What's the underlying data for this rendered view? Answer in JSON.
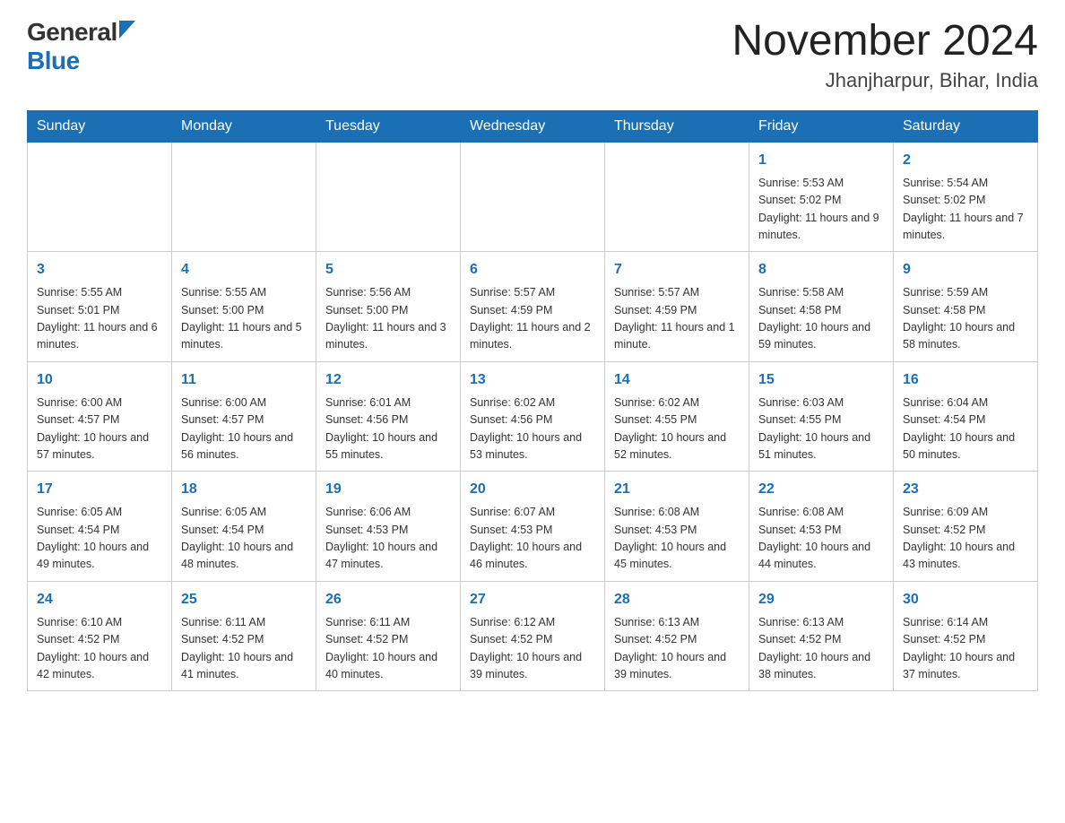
{
  "header": {
    "logo_general": "General",
    "logo_blue": "Blue",
    "month_title": "November 2024",
    "location": "Jhanjharpur, Bihar, India"
  },
  "days_of_week": [
    "Sunday",
    "Monday",
    "Tuesday",
    "Wednesday",
    "Thursday",
    "Friday",
    "Saturday"
  ],
  "weeks": [
    [
      {
        "day": "",
        "info": ""
      },
      {
        "day": "",
        "info": ""
      },
      {
        "day": "",
        "info": ""
      },
      {
        "day": "",
        "info": ""
      },
      {
        "day": "",
        "info": ""
      },
      {
        "day": "1",
        "info": "Sunrise: 5:53 AM\nSunset: 5:02 PM\nDaylight: 11 hours and 9 minutes."
      },
      {
        "day": "2",
        "info": "Sunrise: 5:54 AM\nSunset: 5:02 PM\nDaylight: 11 hours and 7 minutes."
      }
    ],
    [
      {
        "day": "3",
        "info": "Sunrise: 5:55 AM\nSunset: 5:01 PM\nDaylight: 11 hours and 6 minutes."
      },
      {
        "day": "4",
        "info": "Sunrise: 5:55 AM\nSunset: 5:00 PM\nDaylight: 11 hours and 5 minutes."
      },
      {
        "day": "5",
        "info": "Sunrise: 5:56 AM\nSunset: 5:00 PM\nDaylight: 11 hours and 3 minutes."
      },
      {
        "day": "6",
        "info": "Sunrise: 5:57 AM\nSunset: 4:59 PM\nDaylight: 11 hours and 2 minutes."
      },
      {
        "day": "7",
        "info": "Sunrise: 5:57 AM\nSunset: 4:59 PM\nDaylight: 11 hours and 1 minute."
      },
      {
        "day": "8",
        "info": "Sunrise: 5:58 AM\nSunset: 4:58 PM\nDaylight: 10 hours and 59 minutes."
      },
      {
        "day": "9",
        "info": "Sunrise: 5:59 AM\nSunset: 4:58 PM\nDaylight: 10 hours and 58 minutes."
      }
    ],
    [
      {
        "day": "10",
        "info": "Sunrise: 6:00 AM\nSunset: 4:57 PM\nDaylight: 10 hours and 57 minutes."
      },
      {
        "day": "11",
        "info": "Sunrise: 6:00 AM\nSunset: 4:57 PM\nDaylight: 10 hours and 56 minutes."
      },
      {
        "day": "12",
        "info": "Sunrise: 6:01 AM\nSunset: 4:56 PM\nDaylight: 10 hours and 55 minutes."
      },
      {
        "day": "13",
        "info": "Sunrise: 6:02 AM\nSunset: 4:56 PM\nDaylight: 10 hours and 53 minutes."
      },
      {
        "day": "14",
        "info": "Sunrise: 6:02 AM\nSunset: 4:55 PM\nDaylight: 10 hours and 52 minutes."
      },
      {
        "day": "15",
        "info": "Sunrise: 6:03 AM\nSunset: 4:55 PM\nDaylight: 10 hours and 51 minutes."
      },
      {
        "day": "16",
        "info": "Sunrise: 6:04 AM\nSunset: 4:54 PM\nDaylight: 10 hours and 50 minutes."
      }
    ],
    [
      {
        "day": "17",
        "info": "Sunrise: 6:05 AM\nSunset: 4:54 PM\nDaylight: 10 hours and 49 minutes."
      },
      {
        "day": "18",
        "info": "Sunrise: 6:05 AM\nSunset: 4:54 PM\nDaylight: 10 hours and 48 minutes."
      },
      {
        "day": "19",
        "info": "Sunrise: 6:06 AM\nSunset: 4:53 PM\nDaylight: 10 hours and 47 minutes."
      },
      {
        "day": "20",
        "info": "Sunrise: 6:07 AM\nSunset: 4:53 PM\nDaylight: 10 hours and 46 minutes."
      },
      {
        "day": "21",
        "info": "Sunrise: 6:08 AM\nSunset: 4:53 PM\nDaylight: 10 hours and 45 minutes."
      },
      {
        "day": "22",
        "info": "Sunrise: 6:08 AM\nSunset: 4:53 PM\nDaylight: 10 hours and 44 minutes."
      },
      {
        "day": "23",
        "info": "Sunrise: 6:09 AM\nSunset: 4:52 PM\nDaylight: 10 hours and 43 minutes."
      }
    ],
    [
      {
        "day": "24",
        "info": "Sunrise: 6:10 AM\nSunset: 4:52 PM\nDaylight: 10 hours and 42 minutes."
      },
      {
        "day": "25",
        "info": "Sunrise: 6:11 AM\nSunset: 4:52 PM\nDaylight: 10 hours and 41 minutes."
      },
      {
        "day": "26",
        "info": "Sunrise: 6:11 AM\nSunset: 4:52 PM\nDaylight: 10 hours and 40 minutes."
      },
      {
        "day": "27",
        "info": "Sunrise: 6:12 AM\nSunset: 4:52 PM\nDaylight: 10 hours and 39 minutes."
      },
      {
        "day": "28",
        "info": "Sunrise: 6:13 AM\nSunset: 4:52 PM\nDaylight: 10 hours and 39 minutes."
      },
      {
        "day": "29",
        "info": "Sunrise: 6:13 AM\nSunset: 4:52 PM\nDaylight: 10 hours and 38 minutes."
      },
      {
        "day": "30",
        "info": "Sunrise: 6:14 AM\nSunset: 4:52 PM\nDaylight: 10 hours and 37 minutes."
      }
    ]
  ]
}
